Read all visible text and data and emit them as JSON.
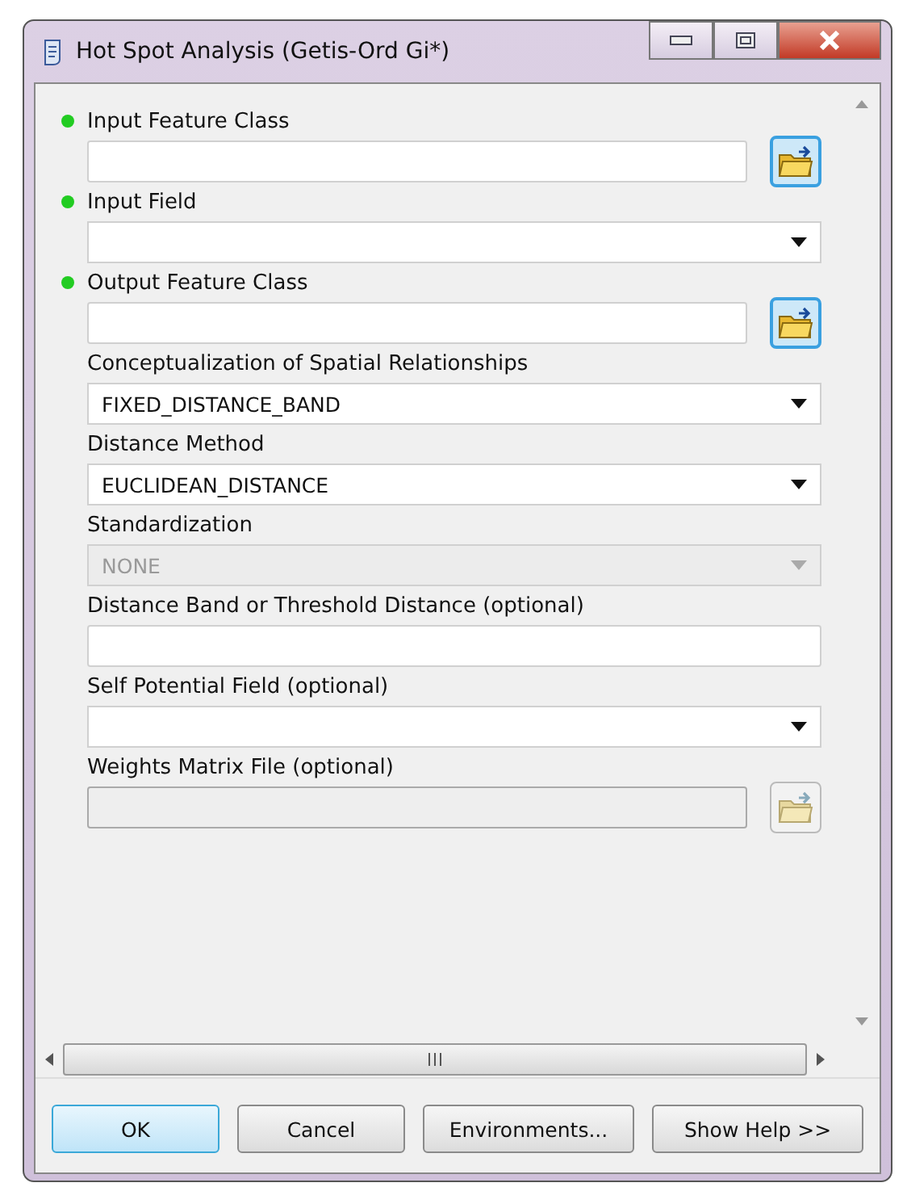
{
  "window": {
    "title": "Hot Spot Analysis (Getis-Ord Gi*)"
  },
  "parameters": [
    {
      "label": "Input Feature Class",
      "required": true,
      "kind": "browse",
      "disabled": false
    },
    {
      "label": "Input Field",
      "required": true,
      "kind": "dropdown",
      "disabled": false
    },
    {
      "label": "Output Feature Class",
      "required": true,
      "kind": "browse",
      "disabled": false
    },
    {
      "label": "Conceptualization of Spatial Relationships",
      "required": false,
      "kind": "dropdown",
      "value": "FIXED_DISTANCE_BAND",
      "disabled": false
    },
    {
      "label": "Distance Method",
      "required": false,
      "kind": "dropdown",
      "value": "EUCLIDEAN_DISTANCE",
      "disabled": false
    },
    {
      "label": "Standardization",
      "required": false,
      "kind": "dropdown",
      "value": "NONE",
      "disabled": true
    },
    {
      "label": "Distance Band or Threshold Distance (optional)",
      "required": false,
      "kind": "text",
      "disabled": false
    },
    {
      "label": "Self Potential Field (optional)",
      "required": false,
      "kind": "dropdown",
      "disabled": false
    },
    {
      "label": "Weights Matrix File (optional)",
      "required": false,
      "kind": "browse",
      "disabled": true
    }
  ],
  "buttons": [
    {
      "label": "OK",
      "default": true
    },
    {
      "label": "Cancel",
      "default": false
    },
    {
      "label": "Environments...",
      "default": false
    },
    {
      "label": "Show Help >>",
      "default": false
    }
  ]
}
